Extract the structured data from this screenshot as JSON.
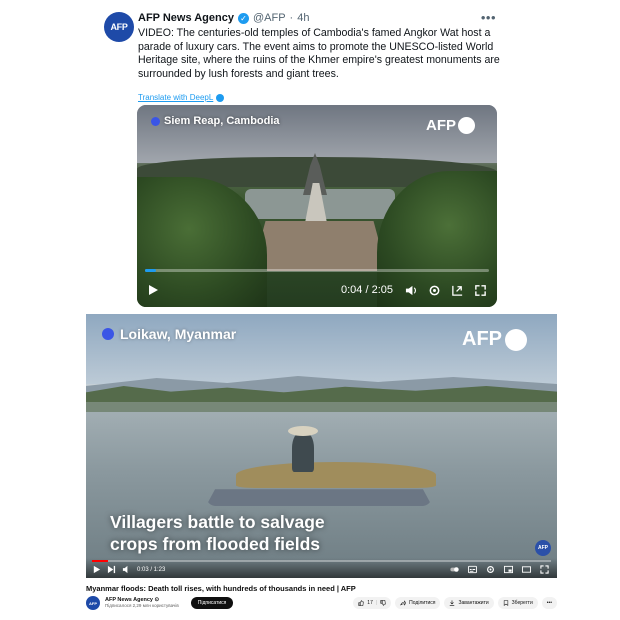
{
  "tweet": {
    "avatar_text": "AFP",
    "name": "AFP News Agency",
    "handle": "@AFP",
    "separator": "·",
    "time": "4h",
    "more": "•••",
    "text": "VIDEO: The centuries-old temples of Cambodia's famed Angkor Wat host a parade of luxury cars. The event aims to promote the UNESCO-listed World Heritage site, where the ruins of the Khmer empire's greatest monuments are surrounded by lush forests and giant trees.",
    "translate_label": "Translate with DeepL",
    "video": {
      "location": "Siem Reap, Cambodia",
      "logo_text": "AFP",
      "time_display": "0:04 / 2:05",
      "progress_fraction": 0.032,
      "accent_color": "#1d9bf0"
    }
  },
  "youtube": {
    "location": "Loikaw, Myanmar",
    "logo_text": "AFP",
    "caption_line1": "Villagers battle to salvage",
    "caption_line2": "crops from flooded fields",
    "badge_text": "AFP",
    "time_display": "0:03 / 1:23",
    "progress_fraction": 0.035,
    "accent_color": "#ff0000",
    "title": "Myanmar floods: Death toll rises, with hundreds of thousands in need | AFP",
    "channel_avatar": "AFP",
    "channel_name": "AFP News Agency",
    "channel_verified": "⊙",
    "subscribers": "Підписалося 2,29 млн користувачів",
    "subscribe_label": "Підписатися",
    "like_count": "17",
    "share_label": "Поділитися",
    "download_label": "Завантажити",
    "save_label": "Зберегти",
    "more_label": "•••"
  }
}
